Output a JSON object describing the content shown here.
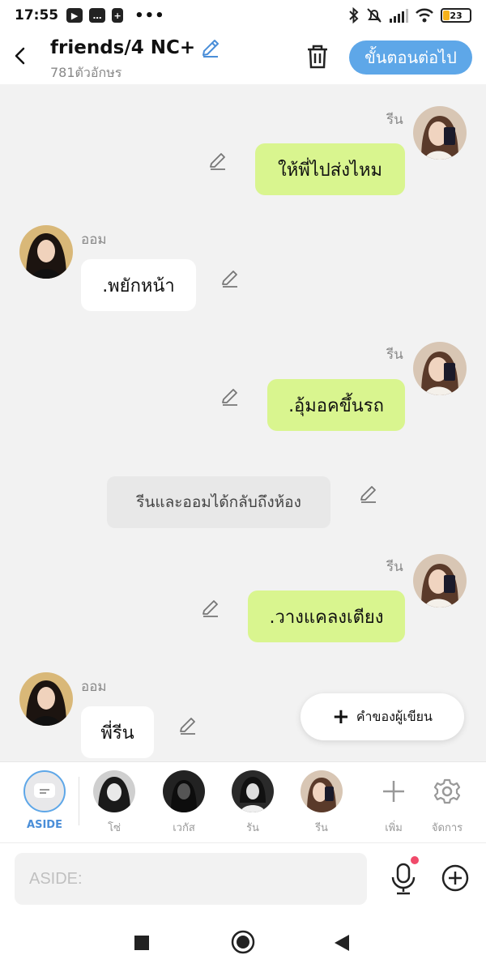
{
  "status": {
    "time": "17:55",
    "battery": "23",
    "battery_level": 0.23
  },
  "header": {
    "title": "friends/4 NC+",
    "subtitle": "781ตัวอักษร",
    "next_label": "ขั้นตอนต่อไป"
  },
  "messages": [
    {
      "type": "me",
      "name": "รีน",
      "text": "ให้พี่ไปส่งไหม"
    },
    {
      "type": "them",
      "name": "ออม",
      "text": ".พยักหน้า"
    },
    {
      "type": "me",
      "name": "รีน",
      "text": ".อุ้มอคขึ้นรถ"
    },
    {
      "type": "narration",
      "text": "รีนและออมได้กลับถึงห้อง"
    },
    {
      "type": "me",
      "name": "รีน",
      "text": ".วางแคลงเตียง"
    },
    {
      "type": "them",
      "name": "ออม",
      "text": "พี่รีน"
    }
  ],
  "fab": {
    "label": "คำของผู้เขียน"
  },
  "characters": [
    {
      "label": "ASIDE",
      "active": true
    },
    {
      "label": "โซ่"
    },
    {
      "label": "เวกัส"
    },
    {
      "label": "รัน"
    },
    {
      "label": "รีน"
    },
    {
      "label": "เพิ่ม"
    },
    {
      "label": "จัดการ"
    }
  ],
  "input": {
    "placeholder": "ASIDE:"
  },
  "colors": {
    "accent": "#5ea7e8",
    "my_bubble": "#d9f58f",
    "their_bubble": "#ffffff",
    "narration": "#e8e8e8"
  }
}
